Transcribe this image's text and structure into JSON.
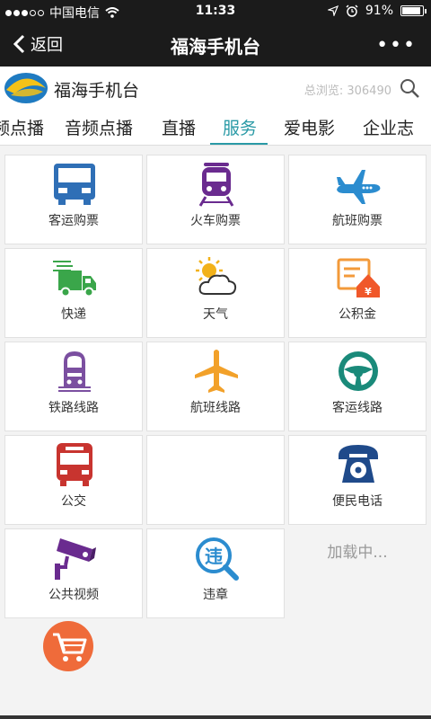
{
  "status_bar": {
    "carrier": "中国电信",
    "time": "11:33",
    "battery": "91%",
    "battery_level": 0.91
  },
  "nav": {
    "back_label": "返回",
    "title": "福海手机台"
  },
  "header": {
    "site_name": "福海手机台",
    "visits_label": "总浏览:",
    "visits_count": "306490"
  },
  "tabs": [
    {
      "label": "频点播"
    },
    {
      "label": "音频点播"
    },
    {
      "label": "直播"
    },
    {
      "label": "服务",
      "active": true
    },
    {
      "label": "爱电影"
    },
    {
      "label": "企业志"
    }
  ],
  "services": [
    {
      "label": "客运购票",
      "icon": "bus-icon"
    },
    {
      "label": "火车购票",
      "icon": "train-icon"
    },
    {
      "label": "航班购票",
      "icon": "airplane-icon"
    },
    {
      "label": "快递",
      "icon": "delivery-truck-icon"
    },
    {
      "label": "天气",
      "icon": "weather-icon"
    },
    {
      "label": "公积金",
      "icon": "housing-fund-icon"
    },
    {
      "label": "铁路线路",
      "icon": "railway-icon"
    },
    {
      "label": "航班线路",
      "icon": "flight-route-icon"
    },
    {
      "label": "客运线路",
      "icon": "steering-wheel-icon"
    },
    {
      "label": "公交",
      "icon": "city-bus-icon"
    },
    {
      "label": "",
      "icon": ""
    },
    {
      "label": "便民电话",
      "icon": "telephone-icon"
    },
    {
      "label": "公共视频",
      "icon": "cctv-camera-icon"
    },
    {
      "label": "违章",
      "icon": "violation-search-icon"
    }
  ],
  "loading_text": "加载中...",
  "colors": {
    "accent": "#2a9aa6",
    "bus": "#2f6fb6",
    "train": "#6a2b8f",
    "plane": "#2b8ccf",
    "green": "#3aa64a",
    "orange": "#f0a03a",
    "red": "#c8342f",
    "navy": "#1f4a8a"
  }
}
